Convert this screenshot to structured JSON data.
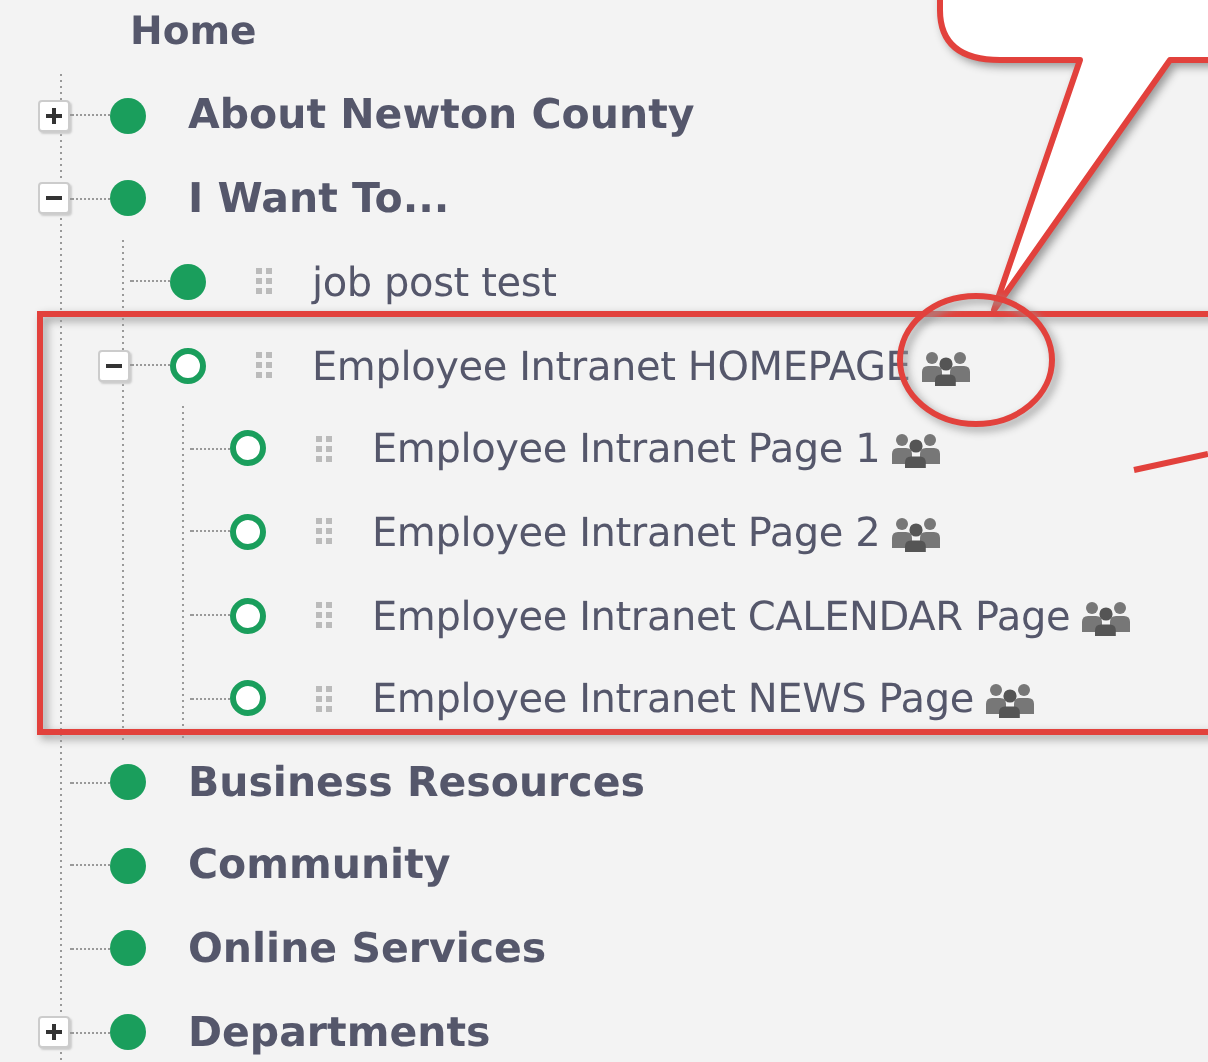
{
  "tree": [
    {
      "label": "Home",
      "kind": "root",
      "children": [
        {
          "label": "About Newton County",
          "kind": "page",
          "published": true,
          "restricted": false,
          "expanded": false
        },
        {
          "label": "I Want To...",
          "kind": "page",
          "published": true,
          "restricted": false,
          "expanded": true,
          "children": [
            {
              "label": "job post test",
              "kind": "page",
              "published": true,
              "restricted": false
            },
            {
              "label": "Employee Intranet HOMEPAGE",
              "kind": "page",
              "published": false,
              "restricted": true,
              "expanded": true,
              "children": [
                {
                  "label": "Employee Intranet Page 1",
                  "kind": "page",
                  "published": false,
                  "restricted": true
                },
                {
                  "label": "Employee Intranet Page 2",
                  "kind": "page",
                  "published": false,
                  "restricted": true
                },
                {
                  "label": "Employee Intranet CALENDAR Page",
                  "kind": "page",
                  "published": false,
                  "restricted": true
                },
                {
                  "label": "Employee Intranet NEWS Page",
                  "kind": "page",
                  "published": false,
                  "restricted": true
                }
              ]
            }
          ]
        },
        {
          "label": "Business Resources",
          "kind": "page",
          "published": true,
          "restricted": false
        },
        {
          "label": "Community",
          "kind": "page",
          "published": true,
          "restricted": false
        },
        {
          "label": "Online Services",
          "kind": "page",
          "published": true,
          "restricted": false
        },
        {
          "label": "Departments",
          "kind": "page",
          "published": true,
          "restricted": false,
          "expanded": false
        }
      ]
    }
  ]
}
